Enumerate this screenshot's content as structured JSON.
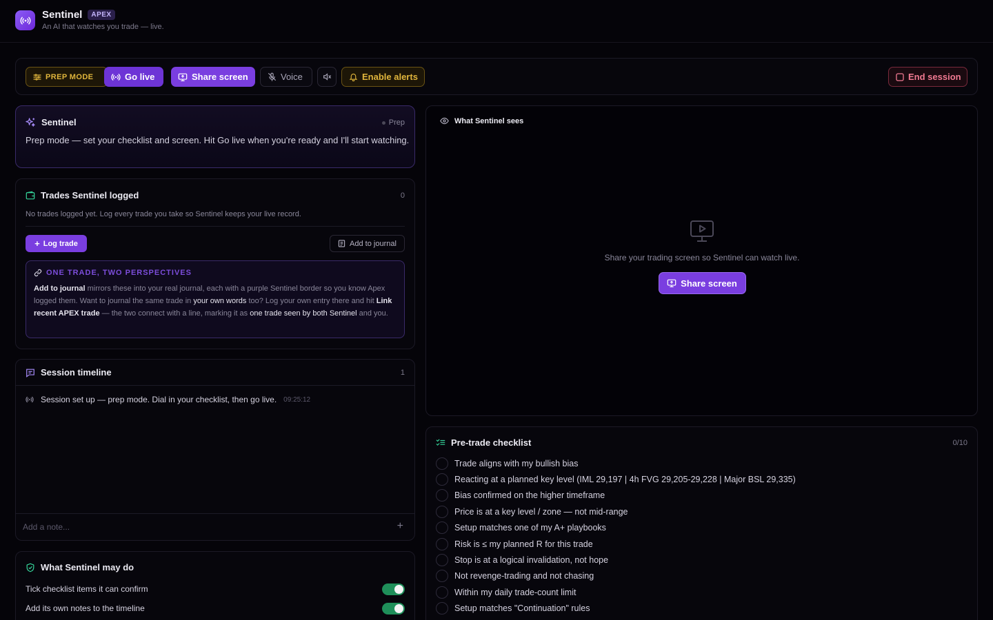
{
  "header": {
    "app_name": "Sentinel",
    "badge": "APEX",
    "tagline": "An AI that watches you trade — live."
  },
  "toolbar": {
    "prep_mode": "PREP MODE",
    "go_live": "Go live",
    "share_screen": "Share screen",
    "voice": "Voice",
    "enable_alerts": "Enable alerts",
    "end_session": "End session"
  },
  "sentinel": {
    "title": "Sentinel",
    "status": "Prep",
    "message": "Prep mode — set your checklist and screen. Hit Go live when you're ready and I'll start watching."
  },
  "trades": {
    "title": "Trades Sentinel logged",
    "count": "0",
    "empty": "No trades logged yet. Log every trade you take so Sentinel keeps your live record.",
    "log_trade": "Log trade",
    "add_to_journal": "Add to journal",
    "perspective_title": "ONE TRADE, TWO PERSPECTIVES",
    "perspective": {
      "p1": "Add to journal",
      "p2": " mirrors these into your real journal, each with a purple Sentinel border so you know Apex logged them. Want to journal the same trade in ",
      "p3": "your own words",
      "p4": " too? Log your own entry there and hit ",
      "p5": "Link recent APEX trade",
      "p6": " — the two connect with a line, marking it as ",
      "p7": "one trade seen by both Sentinel",
      "p8": " and you."
    }
  },
  "timeline": {
    "title": "Session timeline",
    "count": "1",
    "entries": [
      {
        "text": "Session set up — prep mode. Dial in your checklist, then go live.",
        "time": "09:25:12"
      }
    ],
    "note_placeholder": "Add a note..."
  },
  "permissions": {
    "title": "What Sentinel may do",
    "items": [
      {
        "label": "Tick checklist items it can confirm",
        "enabled": true
      },
      {
        "label": "Add its own notes to the timeline",
        "enabled": true
      }
    ]
  },
  "sees": {
    "title": "What Sentinel sees",
    "empty_text": "Share your trading screen so Sentinel can watch live.",
    "share_button": "Share screen"
  },
  "checklist": {
    "title": "Pre-trade checklist",
    "count": "0/10",
    "items": [
      "Trade aligns with my bullish bias",
      "Reacting at a planned key level (IML 29,197 | 4h FVG 29,205-29,228 | Major BSL 29,335)",
      "Bias confirmed on the higher timeframe",
      "Price is at a key level / zone — not mid-range",
      "Setup matches one of my A+ playbooks",
      "Risk is ≤ my planned R for this trade",
      "Stop is at a logical invalidation, not hope",
      "Not revenge-trading and not chasing",
      "Within my daily trade-count limit",
      "Setup matches \"Continuation\" rules"
    ]
  },
  "colors": {
    "accent": "#7a3ee0",
    "warning": "#e0b53c",
    "danger": "#f07a92",
    "success": "#1f8f5a"
  }
}
